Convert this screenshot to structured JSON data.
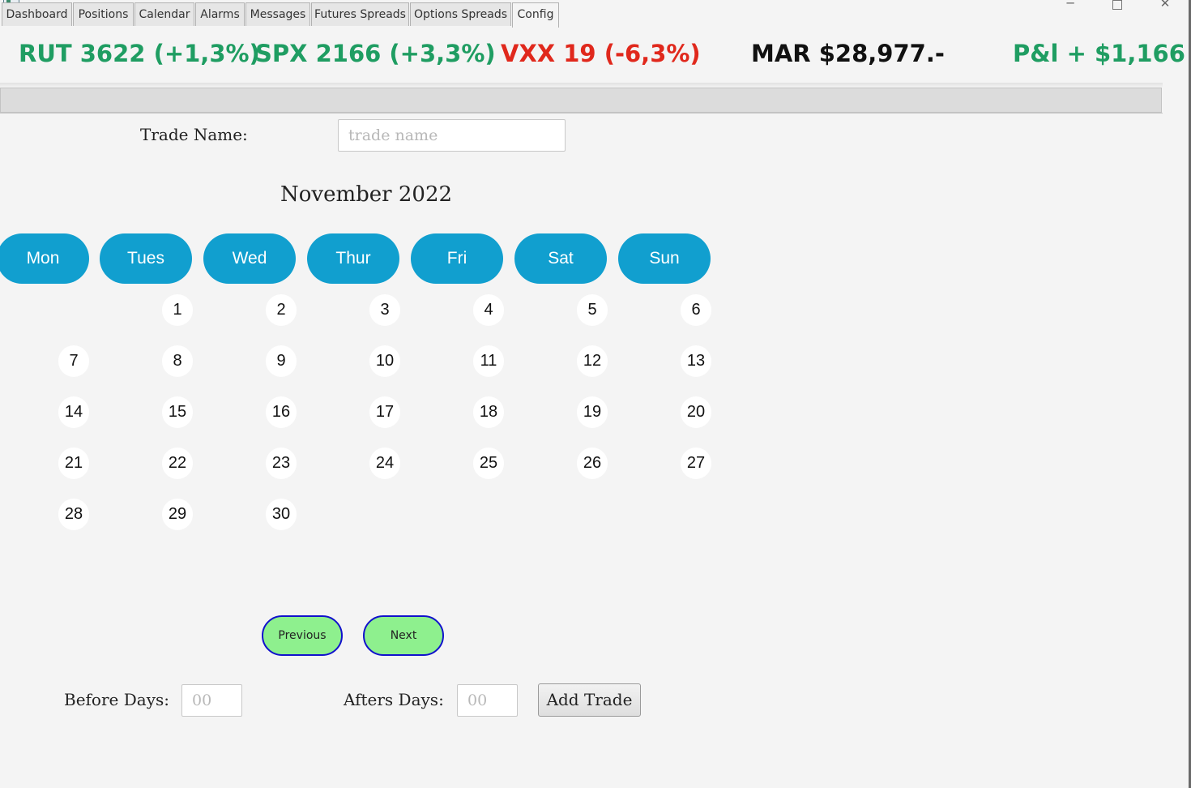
{
  "window": {
    "controls": {
      "minimize": "─",
      "close": "✕"
    },
    "icons": {
      "app": "app-icon",
      "maximize": "maximize-icon"
    }
  },
  "ticker": {
    "rut": {
      "text": "RUT 3622 (+1,3%)",
      "color": "#1f9d62"
    },
    "spx": {
      "text": "SPX 2166 (+3,3%)",
      "color": "#1f9d62"
    },
    "vxx": {
      "text": "VXX 19 (-6,3%)",
      "color": "#e0281c"
    },
    "mar": {
      "text": "MAR $28,977.-",
      "color": "#111111"
    },
    "pnl": {
      "text": "P&l + $1,166",
      "color": "#1f9d62"
    }
  },
  "tabs": [
    {
      "label": "Dashboard"
    },
    {
      "label": "Positions"
    },
    {
      "label": "Calendar"
    },
    {
      "label": "Alarms"
    },
    {
      "label": "Messages"
    },
    {
      "label": "Futures Spreads"
    },
    {
      "label": "Options Spreads"
    },
    {
      "label": "Config",
      "active": true
    }
  ],
  "form": {
    "trade_name_label": "Trade Name:",
    "trade_name_placeholder": "trade name",
    "before_days_label": "Before Days:",
    "before_days_placeholder": "00",
    "after_days_label": "Afters Days:",
    "after_days_placeholder": "00",
    "add_trade_label": "Add Trade"
  },
  "calendar": {
    "month_title": "November 2022",
    "day_headers": [
      "Mon",
      "Tues",
      "Wed",
      "Thur",
      "Fri",
      "Sat",
      "Sun"
    ],
    "weeks": [
      [
        "",
        "1",
        "2",
        "3",
        "4",
        "5",
        "6"
      ],
      [
        "7",
        "8",
        "9",
        "10",
        "11",
        "12",
        "13"
      ],
      [
        "14",
        "15",
        "16",
        "17",
        "18",
        "19",
        "20"
      ],
      [
        "21",
        "22",
        "23",
        "24",
        "25",
        "26",
        "27"
      ],
      [
        "28",
        "29",
        "30",
        "",
        "",
        "",
        ""
      ]
    ],
    "previous_label": "Previous",
    "next_label": "Next"
  },
  "colors": {
    "day_header_bg": "#119fcf",
    "nav_button_bg": "#8ef08e",
    "nav_button_border": "#1111cc"
  }
}
